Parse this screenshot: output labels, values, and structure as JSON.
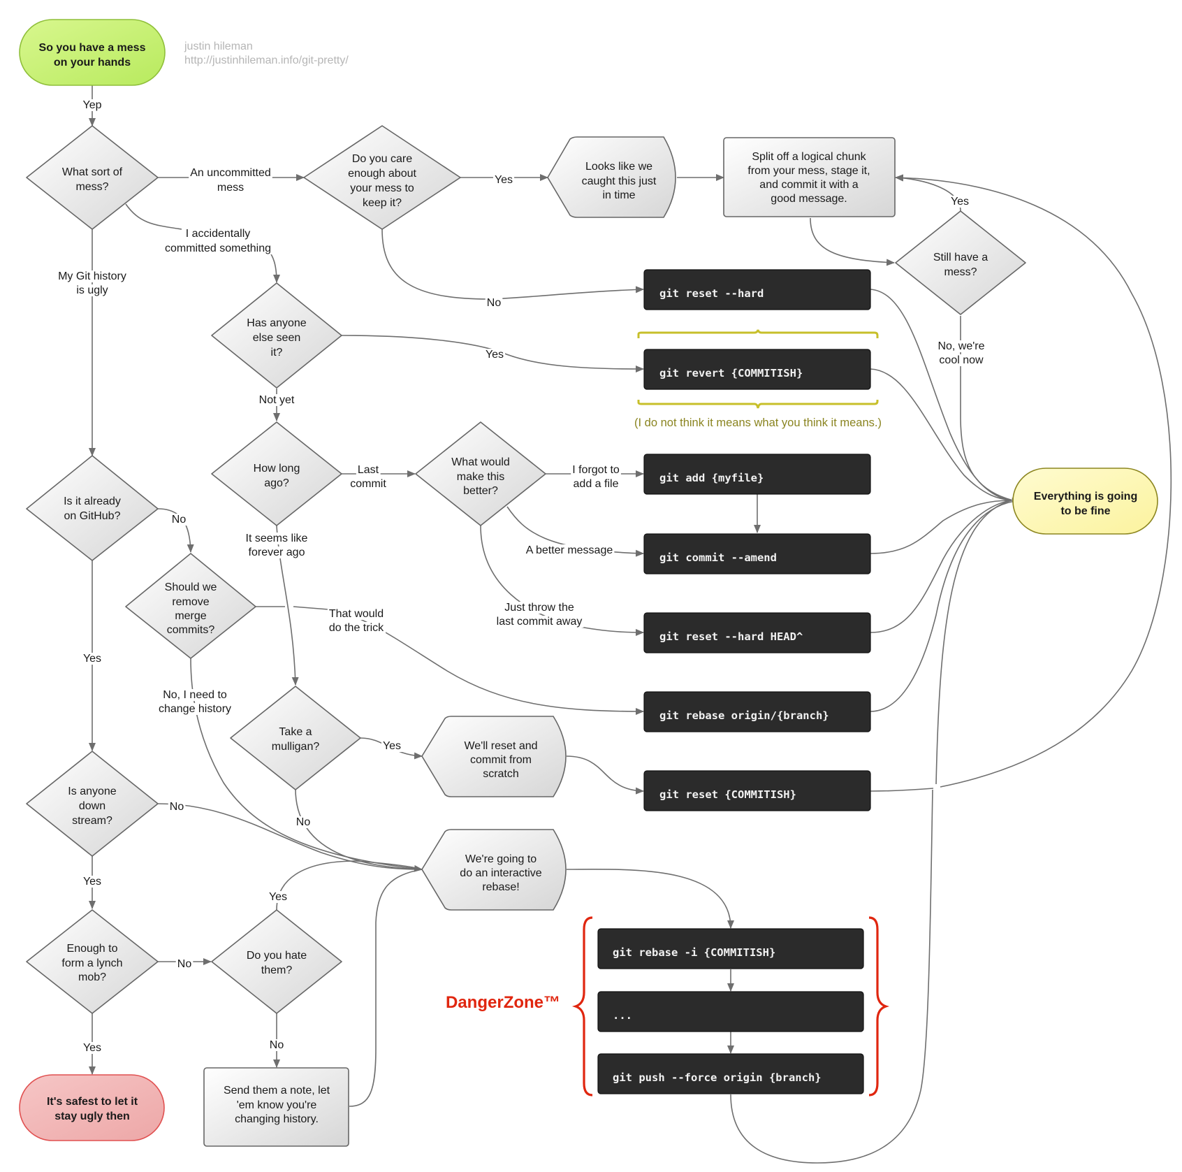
{
  "author": {
    "name": "justin hileman",
    "url": "http://justinhileman.info/git-pretty/"
  },
  "colors": {
    "start_fill": "#c9f27a",
    "start_stroke": "#8fbf3a",
    "fine_fill": "#fdf8b0",
    "fine_stroke": "#8c8620",
    "ugly_fill": "#f2b3b3",
    "ugly_stroke": "#e05050",
    "command_fill": "#2b2b2b",
    "edge": "#6e6e6e",
    "caution_brace": "#c7bf2a",
    "danger": "#e0260f"
  },
  "nodes": {
    "start": [
      "So you have a mess",
      "on your hands"
    ],
    "what_sort": [
      "What sort of",
      "mess?"
    ],
    "care_enough": [
      "Do you care",
      "enough about",
      "your mess to",
      "keep it?"
    ],
    "caught_in_time": [
      "Looks like we",
      "caught this just",
      "in time"
    ],
    "split_off": [
      "Split off a logical chunk",
      "from your mess, stage it,",
      "and commit it with a",
      "good message."
    ],
    "still_mess": [
      "Still have a",
      "mess?"
    ],
    "anyone_seen": [
      "Has anyone",
      "else seen",
      "it?"
    ],
    "how_long": [
      "How long",
      "ago?"
    ],
    "what_better": [
      "What would",
      "make this",
      "better?"
    ],
    "on_github": [
      "Is it already",
      "on GitHub?"
    ],
    "remove_merge": [
      "Should we",
      "remove",
      "merge",
      "commits?"
    ],
    "mulligan": [
      "Take a",
      "mulligan?"
    ],
    "reset_scratch": [
      "We'll reset and",
      "commit from",
      "scratch"
    ],
    "downstream": [
      "Is anyone",
      "down",
      "stream?"
    ],
    "interactive": [
      "We're going to",
      "do an interactive",
      "rebase!"
    ],
    "lynch_mob": [
      "Enough to",
      "form a lynch",
      "mob?"
    ],
    "hate_them": [
      "Do you hate",
      "them?"
    ],
    "send_note": [
      "Send them a note, let",
      "'em know you're",
      "changing history."
    ],
    "stay_ugly": [
      "It's safest to let it",
      "stay ugly then"
    ],
    "fine": [
      "Everything is going",
      "to be fine"
    ]
  },
  "commands": {
    "reset_hard": "git reset --hard",
    "revert": "git revert {COMMITISH}",
    "add": "git add {myfile}",
    "amend": "git commit --amend",
    "reset_head": "git reset --hard HEAD^",
    "rebase_origin": "git rebase origin/{branch}",
    "reset_commitish": "git reset {COMMITISH}",
    "rebase_i": "git rebase -i {COMMITISH}",
    "ellipsis": "...",
    "push_force": "git push --force origin {branch}"
  },
  "labels": {
    "yep": "Yep",
    "uncommitted": [
      "An uncommitted",
      "mess"
    ],
    "accidentally": [
      "I accidentally",
      "committed something"
    ],
    "git_history": [
      "My Git history",
      "is ugly"
    ],
    "care_yes": "Yes",
    "care_no": "No",
    "still_yes": "Yes",
    "cool_now": [
      "No, we're",
      "cool now"
    ],
    "seen_yes": "Yes",
    "not_yet": "Not yet",
    "last_commit": [
      "Last",
      "commit"
    ],
    "forgot_file": [
      "I forgot to",
      "add a file"
    ],
    "better_message": "A better message",
    "throw_away": [
      "Just throw the",
      "last commit away"
    ],
    "forever_ago": [
      "It seems like",
      "forever ago"
    ],
    "github_no": "No",
    "github_yes": "Yes",
    "do_trick": [
      "That would",
      "do the trick"
    ],
    "change_history": [
      "No, I need to",
      "change history"
    ],
    "mulligan_yes": "Yes",
    "mulligan_no": "No",
    "downstream_no": "No",
    "downstream_yes": "Yes",
    "hate_yes": "Yes",
    "lynch_no": "No",
    "hate_no": "No",
    "lynch_yes": "Yes"
  },
  "caption": "(I do not think it means what you think it means.)",
  "danger_zone": "DangerZone™"
}
